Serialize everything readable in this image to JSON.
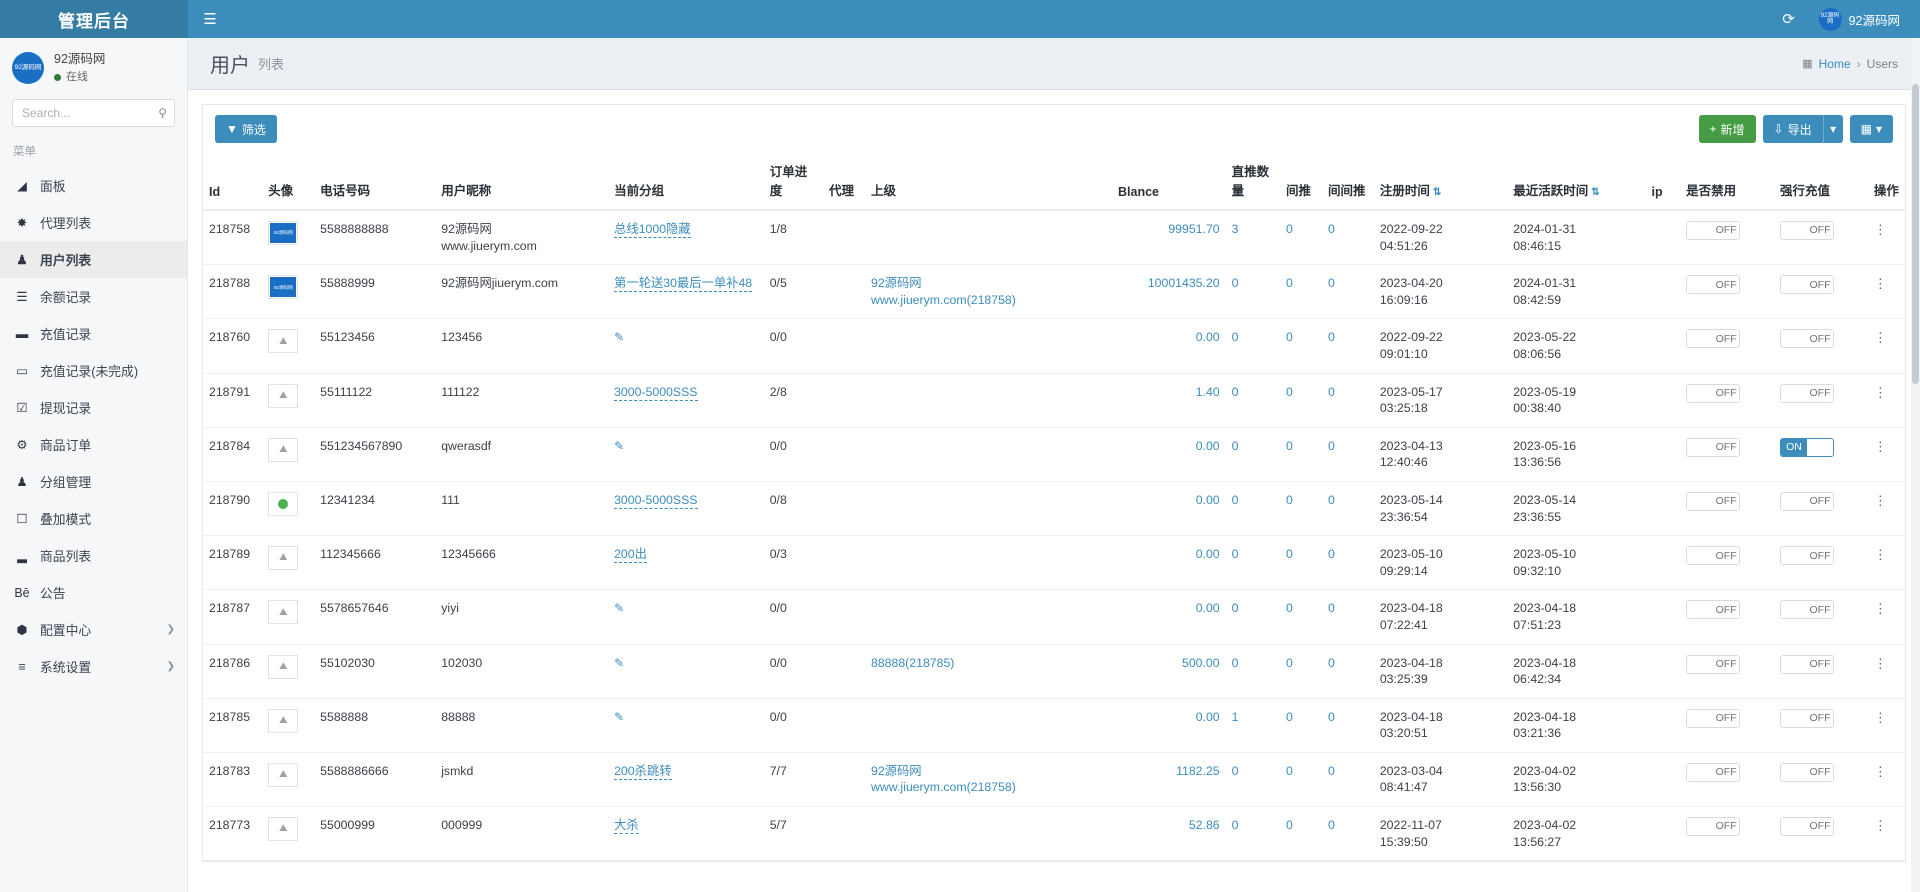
{
  "topbar": {
    "brand": "管理后台",
    "hamburger_icon": "hamburger-icon",
    "refresh_icon": "refresh-icon",
    "user_name": "92源码网",
    "avatar_text": "92源码网"
  },
  "sidebar": {
    "user_name": "92源码网",
    "status": "在线",
    "avatar_text": "92源码网",
    "search_placeholder": "Search...",
    "menu_label": "菜单",
    "items": [
      {
        "label": "面板",
        "icon": "chart-area-icon",
        "active": false,
        "expandable": false
      },
      {
        "label": "代理列表",
        "icon": "cog-icon",
        "active": false,
        "expandable": false
      },
      {
        "label": "用户列表",
        "icon": "user-tie-icon",
        "active": true,
        "expandable": false
      },
      {
        "label": "余额记录",
        "icon": "bars-icon",
        "active": false,
        "expandable": false
      },
      {
        "label": "充值记录",
        "icon": "battery-full-icon",
        "active": false,
        "expandable": false
      },
      {
        "label": "充值记录(未完成)",
        "icon": "battery-empty-icon",
        "active": false,
        "expandable": false
      },
      {
        "label": "提现记录",
        "icon": "check-square-icon",
        "active": false,
        "expandable": false
      },
      {
        "label": "商品订单",
        "icon": "gear-icon",
        "active": false,
        "expandable": false
      },
      {
        "label": "分组管理",
        "icon": "users-icon",
        "active": false,
        "expandable": false
      },
      {
        "label": "叠加模式",
        "icon": "object-group-icon",
        "active": false,
        "expandable": false
      },
      {
        "label": "商品列表",
        "icon": "chart-bar-icon",
        "active": false,
        "expandable": false
      },
      {
        "label": "公告",
        "icon": "behance-icon",
        "active": false,
        "expandable": false
      },
      {
        "label": "配置中心",
        "icon": "hexagon-icon",
        "active": false,
        "expandable": true
      },
      {
        "label": "系统设置",
        "icon": "list-icon",
        "active": false,
        "expandable": true
      }
    ],
    "chevron_icon": "chevron-right-icon"
  },
  "page": {
    "title": "用户",
    "subtitle": "列表",
    "breadcrumb_home": "Home",
    "breadcrumb_current": "Users",
    "breadcrumb_home_icon": "dashboard-icon",
    "breadcrumb_sep": "›"
  },
  "toolbar": {
    "filter_label": "筛选",
    "filter_icon": "funnel-icon",
    "add_label": "新增",
    "add_icon": "plus-icon",
    "export_label": "导出",
    "export_icon": "download-icon",
    "caret_icon": "caret-down-icon",
    "columns_icon": "table-icon",
    "columns_caret_icon": "caret-down-icon"
  },
  "table": {
    "columns": [
      {
        "key": "id",
        "label": "Id",
        "sortable": false
      },
      {
        "key": "avatar",
        "label": "头像",
        "sortable": false
      },
      {
        "key": "phone",
        "label": "电话号码",
        "sortable": false
      },
      {
        "key": "nickname",
        "label": "用户昵称",
        "sortable": false
      },
      {
        "key": "group",
        "label": "当前分组",
        "sortable": false
      },
      {
        "key": "progress",
        "label": "订单进度",
        "sortable": false
      },
      {
        "key": "agent",
        "label": "代理",
        "sortable": false
      },
      {
        "key": "parent",
        "label": "上级",
        "sortable": false
      },
      {
        "key": "balance",
        "label": "Blance",
        "sortable": false
      },
      {
        "key": "direct",
        "label": "直推数量",
        "sortable": false
      },
      {
        "key": "indirect1",
        "label": "间推",
        "sortable": false
      },
      {
        "key": "indirect2",
        "label": "间间推",
        "sortable": false
      },
      {
        "key": "reg_time",
        "label": "注册时间",
        "sortable": true
      },
      {
        "key": "active_time",
        "label": "最近活跃时间",
        "sortable": true
      },
      {
        "key": "ip",
        "label": "ip",
        "sortable": false
      },
      {
        "key": "disabled",
        "label": "是否禁用",
        "sortable": false
      },
      {
        "key": "force_recharge",
        "label": "强行充值",
        "sortable": false
      },
      {
        "key": "action",
        "label": "操作",
        "sortable": false
      }
    ],
    "sort_icon": "sort-icon",
    "pencil_icon": "pencil-icon",
    "kebab_icon": "vertical-ellipsis-icon",
    "toggle_off_label": "OFF",
    "toggle_on_label": "ON",
    "rows": [
      {
        "id": "218758",
        "avatar_type": "logo",
        "avatar_text": "92源码网",
        "phone": "5588888888",
        "nickname_line1": "92源码网",
        "nickname_line2": "www.jiuerym.com",
        "group": "总线1000隐藏",
        "group_is_link": true,
        "progress": "1/8",
        "agent": "",
        "parent_line1": "",
        "parent_line2": "",
        "balance": "99951.70",
        "direct": "3",
        "indirect1": "0",
        "indirect2": "0",
        "reg_date": "2022-09-22",
        "reg_time": "04:51:26",
        "active_date": "2024-01-31",
        "active_time": "08:46:15",
        "ip": "",
        "disabled": "OFF",
        "force_recharge": "OFF"
      },
      {
        "id": "218788",
        "avatar_type": "logo",
        "avatar_text": "92源码网",
        "phone": "55888999",
        "nickname_line1": "92源码网jiuerym.com",
        "nickname_line2": "",
        "group": "第一轮送30最后一单补48",
        "group_is_link": true,
        "progress": "0/5",
        "agent": "",
        "parent_line1": "92源码网",
        "parent_line2": "www.jiuerym.com(218758)",
        "balance": "10001435.20",
        "direct": "0",
        "indirect1": "0",
        "indirect2": "0",
        "reg_date": "2023-04-20",
        "reg_time": "16:09:16",
        "active_date": "2024-01-31",
        "active_time": "08:42:59",
        "ip": "",
        "disabled": "OFF",
        "force_recharge": "OFF"
      },
      {
        "id": "218760",
        "avatar_type": "broken",
        "avatar_text": "",
        "phone": "55123456",
        "nickname_line1": "123456",
        "nickname_line2": "",
        "group": "",
        "group_is_link": false,
        "progress": "0/0",
        "agent": "",
        "parent_line1": "",
        "parent_line2": "",
        "balance": "0.00",
        "direct": "0",
        "indirect1": "0",
        "indirect2": "0",
        "reg_date": "2022-09-22",
        "reg_time": "09:01:10",
        "active_date": "2023-05-22",
        "active_time": "08:06:56",
        "ip": "",
        "disabled": "OFF",
        "force_recharge": "OFF"
      },
      {
        "id": "218791",
        "avatar_type": "broken",
        "avatar_text": "",
        "phone": "55111122",
        "nickname_line1": "111122",
        "nickname_line2": "",
        "group": "3000-5000SSS",
        "group_is_link": true,
        "progress": "2/8",
        "agent": "",
        "parent_line1": "",
        "parent_line2": "",
        "balance": "1.40",
        "direct": "0",
        "indirect1": "0",
        "indirect2": "0",
        "reg_date": "2023-05-17",
        "reg_time": "03:25:18",
        "active_date": "2023-05-19",
        "active_time": "00:38:40",
        "ip": "",
        "disabled": "OFF",
        "force_recharge": "OFF"
      },
      {
        "id": "218784",
        "avatar_type": "broken",
        "avatar_text": "",
        "phone": "551234567890",
        "nickname_line1": "qwerasdf",
        "nickname_line2": "",
        "group": "",
        "group_is_link": false,
        "progress": "0/0",
        "agent": "",
        "parent_line1": "",
        "parent_line2": "",
        "balance": "0.00",
        "direct": "0",
        "indirect1": "0",
        "indirect2": "0",
        "reg_date": "2023-04-13",
        "reg_time": "12:40:46",
        "active_date": "2023-05-16",
        "active_time": "13:36:56",
        "ip": "",
        "disabled": "OFF",
        "force_recharge": "ON"
      },
      {
        "id": "218790",
        "avatar_type": "circle",
        "avatar_text": "",
        "phone": "12341234",
        "nickname_line1": "111",
        "nickname_line2": "",
        "group": "3000-5000SSS",
        "group_is_link": true,
        "progress": "0/8",
        "agent": "",
        "parent_line1": "",
        "parent_line2": "",
        "balance": "0.00",
        "direct": "0",
        "indirect1": "0",
        "indirect2": "0",
        "reg_date": "2023-05-14",
        "reg_time": "23:36:54",
        "active_date": "2023-05-14",
        "active_time": "23:36:55",
        "ip": "",
        "disabled": "OFF",
        "force_recharge": "OFF"
      },
      {
        "id": "218789",
        "avatar_type": "broken",
        "avatar_text": "",
        "phone": "112345666",
        "nickname_line1": "12345666",
        "nickname_line2": "",
        "group": "200出",
        "group_is_link": true,
        "progress": "0/3",
        "agent": "",
        "parent_line1": "",
        "parent_line2": "",
        "balance": "0.00",
        "direct": "0",
        "indirect1": "0",
        "indirect2": "0",
        "reg_date": "2023-05-10",
        "reg_time": "09:29:14",
        "active_date": "2023-05-10",
        "active_time": "09:32:10",
        "ip": "",
        "disabled": "OFF",
        "force_recharge": "OFF"
      },
      {
        "id": "218787",
        "avatar_type": "broken",
        "avatar_text": "",
        "phone": "5578657646",
        "nickname_line1": "yiyi",
        "nickname_line2": "",
        "group": "",
        "group_is_link": false,
        "progress": "0/0",
        "agent": "",
        "parent_line1": "",
        "parent_line2": "",
        "balance": "0.00",
        "direct": "0",
        "indirect1": "0",
        "indirect2": "0",
        "reg_date": "2023-04-18",
        "reg_time": "07:22:41",
        "active_date": "2023-04-18",
        "active_time": "07:51:23",
        "ip": "",
        "disabled": "OFF",
        "force_recharge": "OFF"
      },
      {
        "id": "218786",
        "avatar_type": "broken",
        "avatar_text": "",
        "phone": "55102030",
        "nickname_line1": "102030",
        "nickname_line2": "",
        "group": "",
        "group_is_link": false,
        "progress": "0/0",
        "agent": "",
        "parent_line1": "88888(218785)",
        "parent_line2": "",
        "balance": "500.00",
        "direct": "0",
        "indirect1": "0",
        "indirect2": "0",
        "reg_date": "2023-04-18",
        "reg_time": "03:25:39",
        "active_date": "2023-04-18",
        "active_time": "06:42:34",
        "ip": "",
        "disabled": "OFF",
        "force_recharge": "OFF"
      },
      {
        "id": "218785",
        "avatar_type": "broken",
        "avatar_text": "",
        "phone": "5588888",
        "nickname_line1": "88888",
        "nickname_line2": "",
        "group": "",
        "group_is_link": false,
        "progress": "0/0",
        "agent": "",
        "parent_line1": "",
        "parent_line2": "",
        "balance": "0.00",
        "direct": "1",
        "indirect1": "0",
        "indirect2": "0",
        "reg_date": "2023-04-18",
        "reg_time": "03:20:51",
        "active_date": "2023-04-18",
        "active_time": "03:21:36",
        "ip": "",
        "disabled": "OFF",
        "force_recharge": "OFF"
      },
      {
        "id": "218783",
        "avatar_type": "broken",
        "avatar_text": "",
        "phone": "5588886666",
        "nickname_line1": "jsmkd",
        "nickname_line2": "",
        "group": "200杀跳转",
        "group_is_link": true,
        "progress": "7/7",
        "agent": "",
        "parent_line1": "92源码网",
        "parent_line2": "www.jiuerym.com(218758)",
        "balance": "1182.25",
        "direct": "0",
        "indirect1": "0",
        "indirect2": "0",
        "reg_date": "2023-03-04",
        "reg_time": "08:41:47",
        "active_date": "2023-04-02",
        "active_time": "13:56:30",
        "ip": "",
        "disabled": "OFF",
        "force_recharge": "OFF"
      },
      {
        "id": "218773",
        "avatar_type": "broken",
        "avatar_text": "",
        "phone": "55000999",
        "nickname_line1": "000999",
        "nickname_line2": "",
        "group": "大杀",
        "group_is_link": true,
        "progress": "5/7",
        "agent": "",
        "parent_line1": "",
        "parent_line2": "",
        "balance": "52.86",
        "direct": "0",
        "indirect1": "0",
        "indirect2": "0",
        "reg_date": "2022-11-07",
        "reg_time": "15:39:50",
        "active_date": "2023-04-02",
        "active_time": "13:56:27",
        "ip": "",
        "disabled": "OFF",
        "force_recharge": "OFF"
      }
    ]
  },
  "colors": {
    "primary": "#3c8dbc",
    "primary_dark": "#357ca5",
    "success": "#449d44",
    "link": "#3c8dbc"
  }
}
